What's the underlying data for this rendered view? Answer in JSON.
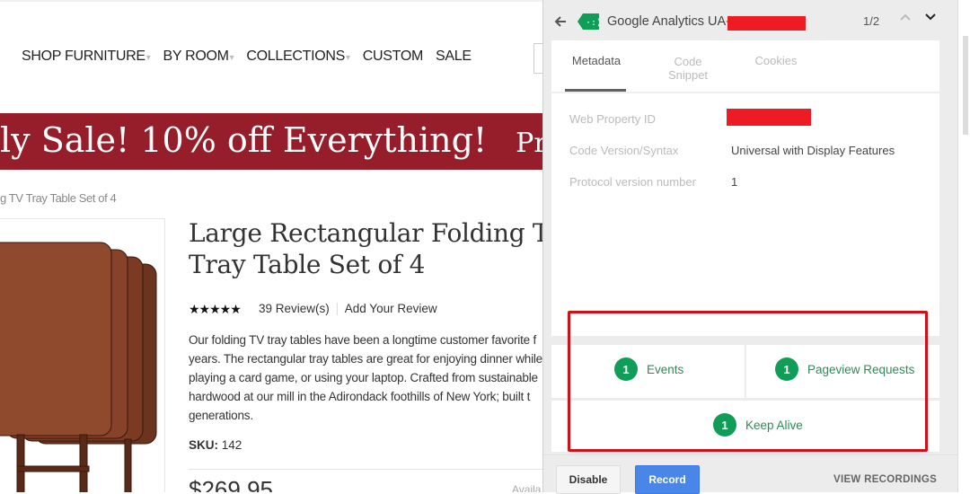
{
  "site": {
    "nav": [
      {
        "label": "SHOP FURNITURE",
        "caret": true
      },
      {
        "label": "BY ROOM",
        "caret": true
      },
      {
        "label": "COLLECTIONS",
        "caret": true
      },
      {
        "label": "CUSTOM",
        "caret": false
      },
      {
        "label": "SALE",
        "caret": false
      }
    ],
    "banner": {
      "text": "ly Sale! 10% off Everything!",
      "promo": "Pron",
      "color": "#961e2b"
    },
    "breadcrumb": "g TV Tray Table Set of 4",
    "product": {
      "title_line1": "Large Rectangular Folding T",
      "title_line2": "Tray Table Set of 4",
      "stars": "★★★★★",
      "rating": 5,
      "reviews": "39 Review(s)",
      "add_review": "Add Your Review",
      "description": [
        "Our folding TV tray tables have been a longtime customer favorite f",
        "years. The rectangular tray tables are great for enjoying dinner while",
        "playing a card game, or using your laptop. Crafted from sustainable",
        "hardwood at our mill in the Adirondack foothills of New York; built t",
        "generations."
      ],
      "sku_label": "SKU:",
      "sku": "142",
      "price": "$269.95",
      "availability": "Availa"
    }
  },
  "panel": {
    "title": "Google Analytics UA-",
    "pager": "1/2",
    "tabs": [
      {
        "label": "Metadata",
        "active": true
      },
      {
        "label": "Code Snippet",
        "active": false
      },
      {
        "label": "Cookies",
        "active": false
      }
    ],
    "rows": [
      {
        "label": "Web Property ID",
        "value": "",
        "redacted": true
      },
      {
        "label": "Code Version/Syntax",
        "value": "Universal with Display Features"
      },
      {
        "label": "Protocol version number",
        "value": "1"
      }
    ],
    "stats": [
      {
        "count": "1",
        "label": "Events"
      },
      {
        "count": "1",
        "label": "Pageview Requests"
      },
      {
        "count": "1",
        "label": "Keep Alive"
      }
    ],
    "buttons": {
      "disable": "Disable",
      "record": "Record",
      "view_recordings": "VIEW RECORDINGS"
    },
    "colors": {
      "badge": "#0f9d58",
      "record": "#4285f4",
      "highlight": "#d0111b",
      "tag": "#0f9d58"
    }
  }
}
